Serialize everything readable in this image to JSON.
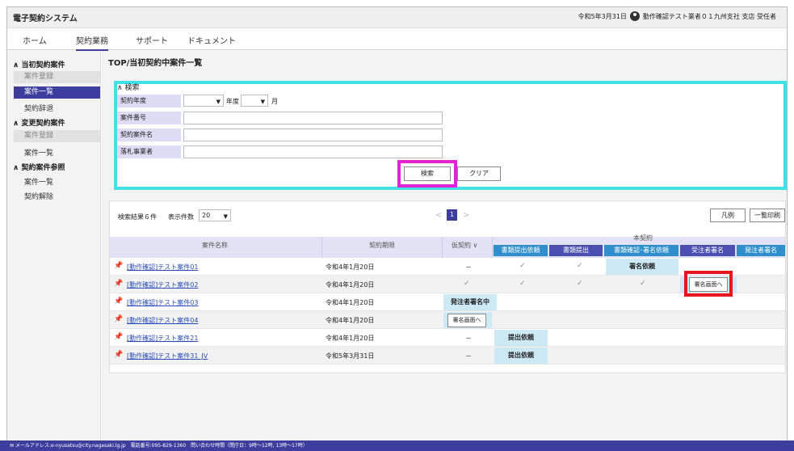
{
  "app": {
    "title": "電子契約システム"
  },
  "user": {
    "info": "令和5年3月31日",
    "name": "動作確認テスト業者０１九州支社 支店 受任者"
  },
  "nav": {
    "tabs": [
      "ホーム",
      "契約業務",
      "サポート",
      "ドキュメント"
    ]
  },
  "sidebar": {
    "group1": "当初契約案件",
    "group1_items": [
      "案件登録",
      "案件一覧",
      "契約辞退"
    ],
    "group2": "変更契約案件",
    "group2_items": [
      "案件登録",
      "案件一覧"
    ],
    "group3": "契約案件参照",
    "group3_items": [
      "案件一覧",
      "契約解除"
    ]
  },
  "page": {
    "title": "TOP/当初契約中案件一覧"
  },
  "search": {
    "header": "検索",
    "fiscal_year_label": "契約年度",
    "year_unit": "年度",
    "month_unit": "月",
    "case_no_label": "案件番号",
    "case_name_label": "契約案件名",
    "bidder_label": "落札事業者",
    "search_button": "検索",
    "clear_button": "クリア"
  },
  "results": {
    "count_text": "検索結果６件",
    "per_page_label": "表示件数",
    "per_page_value": "20",
    "page_current": "1",
    "legend_button": "凡例",
    "print_button": "一覧印刷",
    "col_name": "案件名称",
    "col_deadline": "契約期限",
    "col_provisional": "仮契約",
    "col_main": "本契約",
    "stages": [
      "書類提出依頼",
      "書類提出",
      "書類確認･署名依頼",
      "受注者署名",
      "発注者署名"
    ],
    "rows": [
      {
        "name": "[動作確認]テスト案件01",
        "date": "令和4年1月20日",
        "prov": "－"
      },
      {
        "name": "[動作確認]テスト案件02",
        "date": "令和4年1月20日",
        "prov": "✓"
      },
      {
        "name": "[動作確認]テスト案件03",
        "date": "令和4年1月20日",
        "prov": ""
      },
      {
        "name": "[動作確認]テスト案件04",
        "date": "令和4年1月20日",
        "prov": ""
      },
      {
        "name": "[動作確認]テスト案件21",
        "date": "令和4年1月20日",
        "prov": "－"
      },
      {
        "name": "[動作確認]テスト案件31_JV",
        "date": "令和5年3月31日",
        "prov": "－"
      }
    ],
    "sign_request": "署名依頼",
    "sign_screen": "署名画面へ",
    "orderer_signing": "発注者署名中",
    "submit_request": "提出依頼"
  },
  "footer": {
    "text": "メールアドレス:e-nyusatsu@city.nagasaki.lg.jp　電話番号:095-829-1360　問い合わせ時間（閉庁日：9時〜12時, 13時〜17時）"
  }
}
